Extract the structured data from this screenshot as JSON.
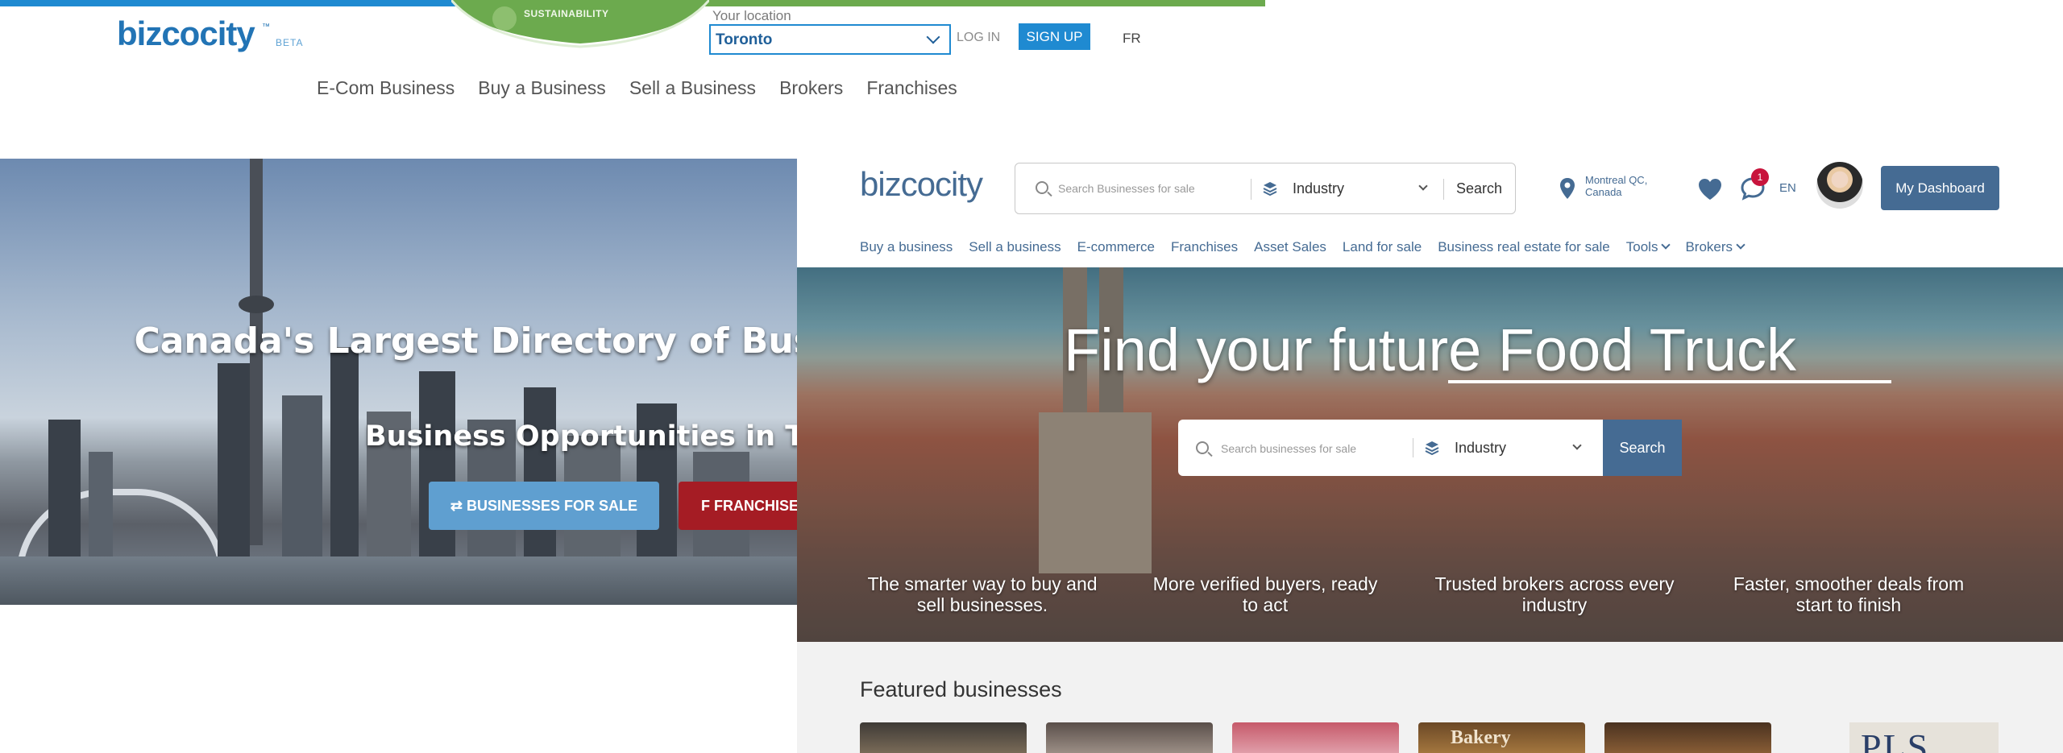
{
  "old_site": {
    "logo": "bizcocity",
    "logo_tm": "™",
    "beta": "BETA",
    "sustainability": "SUSTAINABILITY",
    "location_label": "Your location",
    "location_value": "Toronto",
    "login": "LOG IN",
    "signup": "SIGN UP",
    "lang": "FR",
    "nav": [
      "E-Com Business",
      "Buy a Business",
      "Sell a Business",
      "Brokers",
      "Franchises"
    ],
    "hero": {
      "headline": "Canada's Largest Directory of Businesses for Sale",
      "subline": "Business Opportunities in Toronto",
      "btn_businesses": "BUSINESSES FOR SALE",
      "btn_franchises": "FRANCHISES"
    }
  },
  "new_site": {
    "logo": "bizcocity",
    "search": {
      "placeholder": "Search Businesses for sale",
      "industry": "Industry",
      "button": "Search"
    },
    "location_line1": "Montreal QC,",
    "location_line2": "Canada",
    "messages_badge": "1",
    "lang": "EN",
    "dashboard": "My Dashboard",
    "nav": {
      "buy": "Buy a business",
      "sell": "Sell a business",
      "ecommerce": "E-commerce",
      "franchises": "Franchises",
      "asset_sales": "Asset Sales",
      "land": "Land for sale",
      "real_estate": "Business real estate for sale",
      "tools": "Tools",
      "brokers": "Brokers"
    },
    "hero": {
      "title": "Find your future Food Truck",
      "search_placeholder": "Search businesses for sale",
      "industry": "Industry",
      "search_button": "Search",
      "features": [
        "The smarter way to buy and sell businesses.",
        "More verified buyers, ready to act",
        "Trusted brokers across every industry",
        "Faster, smoother deals from start to finish"
      ]
    },
    "featured": {
      "title": "Featured businesses",
      "card_label": "Bakery",
      "logo_text": "PLS"
    }
  },
  "colors": {
    "old_blue": "#1f8ad1",
    "old_green": "#6caa4e",
    "new_brand": "#456b93",
    "badge_red": "#c8143c",
    "franchise_red": "#a51c24"
  }
}
